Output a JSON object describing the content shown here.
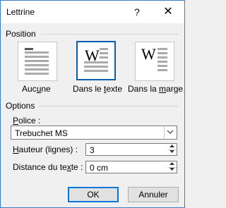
{
  "window": {
    "title": "Lettrine",
    "help_label": "?",
    "close_label": "✕"
  },
  "position": {
    "label": "Position",
    "options": [
      {
        "pre": "Auc",
        "mn": "u",
        "post": "ne"
      },
      {
        "pre": "Dans le ",
        "mn": "t",
        "post": "exte"
      },
      {
        "pre": "Dans la ",
        "mn": "m",
        "post": "arge"
      }
    ],
    "drop_letter": "W",
    "selected_index": 1
  },
  "options": {
    "label": "Options",
    "font_label": {
      "pre": "",
      "mn": "P",
      "post": "olice :"
    },
    "font_value": "Trebuchet MS",
    "height_label": {
      "pre": "",
      "mn": "H",
      "post": "auteur (lignes) :"
    },
    "height_value": "3",
    "distance_label": {
      "pre": "Distance du te",
      "mn": "x",
      "post": "te :"
    },
    "distance_value": "0 cm"
  },
  "buttons": {
    "ok": "OK",
    "cancel": "Annuler"
  }
}
